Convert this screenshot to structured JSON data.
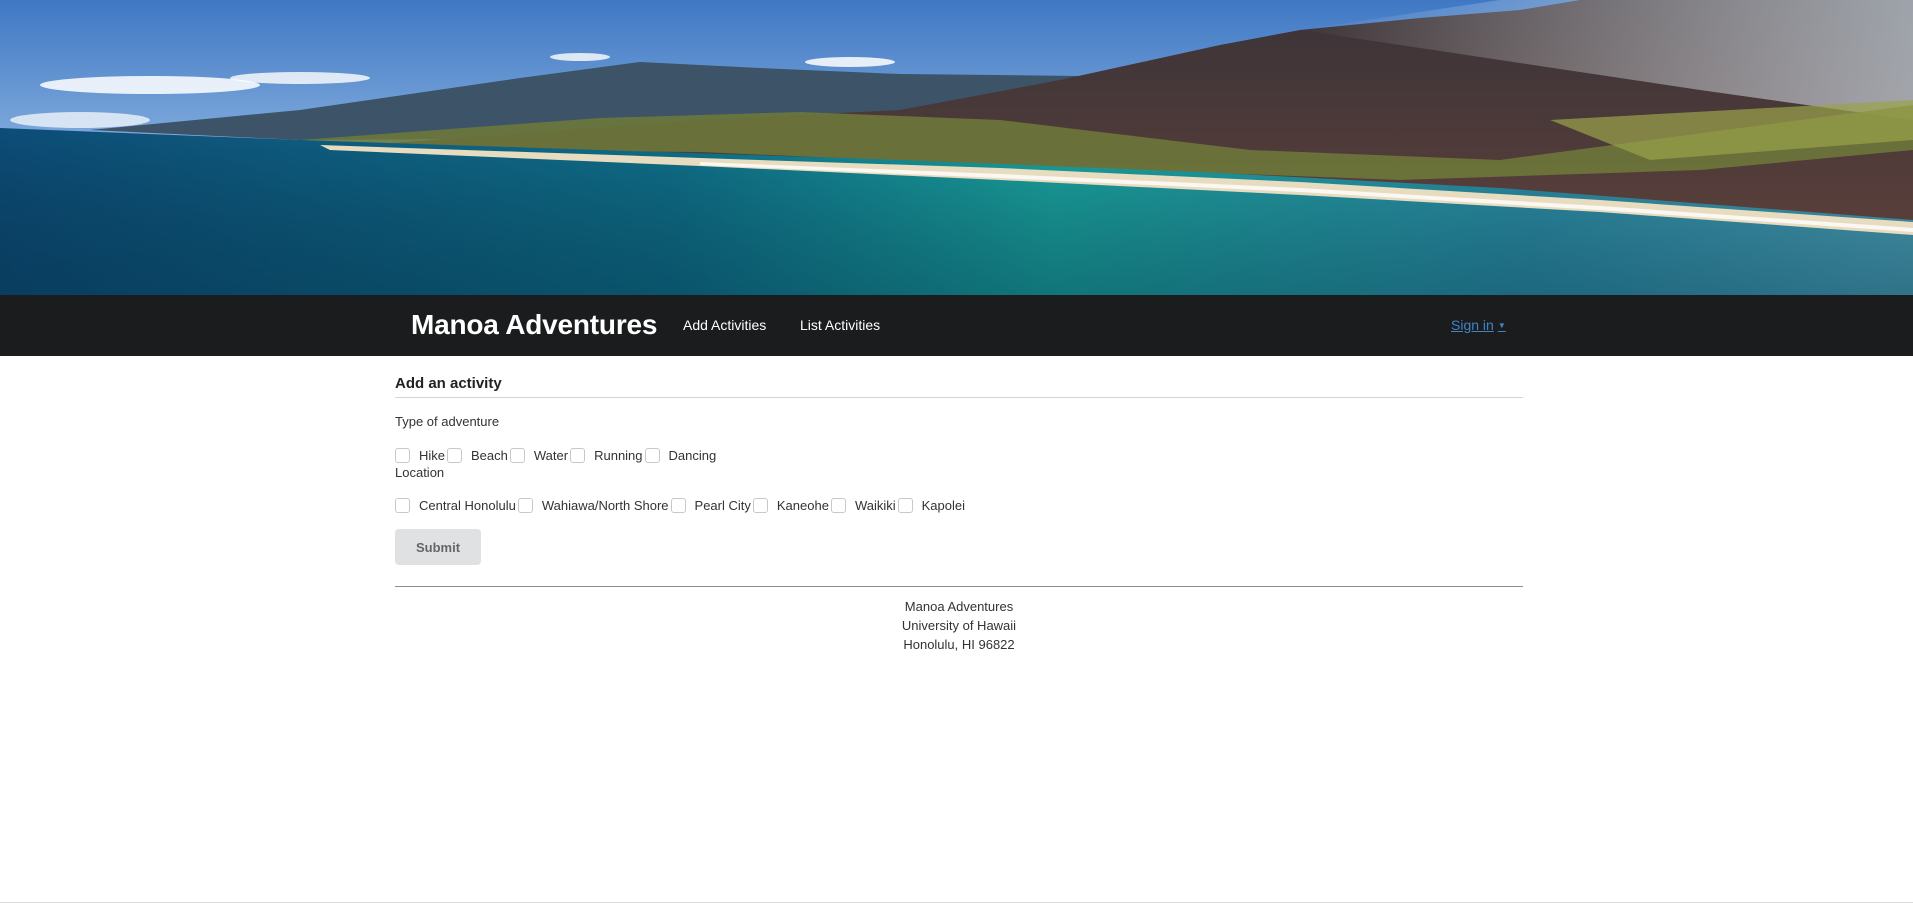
{
  "app": {
    "brand": "Manoa Adventures"
  },
  "nav": {
    "add_activities": "Add Activities",
    "list_activities": "List Activities",
    "sign_in": "Sign in",
    "sign_in_caret": "▼"
  },
  "form": {
    "header": "Add an activity",
    "type_label": "Type of adventure",
    "types": [
      "Hike",
      "Beach",
      "Water",
      "Running",
      "Dancing"
    ],
    "location_label": "Location",
    "locations": [
      "Central Honolulu",
      "Wahiawa/North Shore",
      "Pearl City",
      "Kaneohe",
      "Waikiki",
      "Kapolei"
    ],
    "submit": "Submit"
  },
  "footer": {
    "line1": "Manoa Adventures",
    "line2": "University of Hawaii",
    "line3": "Honolulu, HI 96822"
  },
  "colors": {
    "navbar_bg": "#1b1c1d",
    "link": "#4183c4",
    "button_bg": "#e0e1e2"
  }
}
